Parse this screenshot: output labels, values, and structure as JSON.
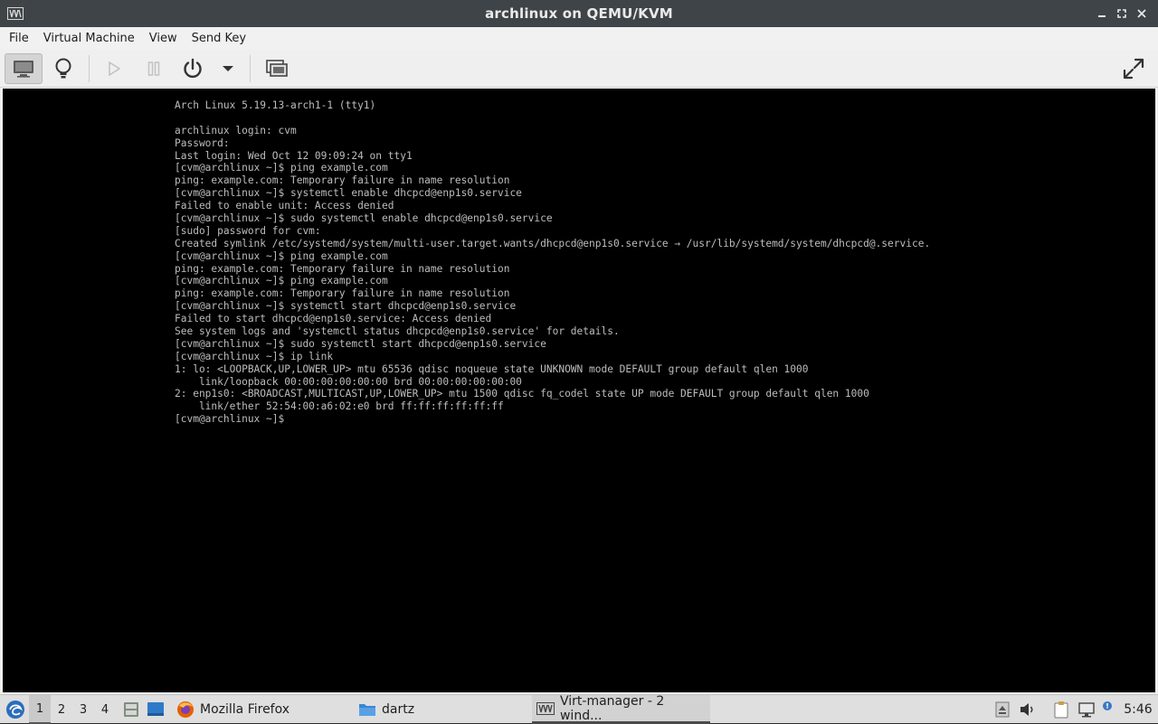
{
  "window": {
    "title": "archlinux on QEMU/KVM"
  },
  "menubar": {
    "items": [
      "File",
      "Virtual Machine",
      "View",
      "Send Key"
    ]
  },
  "toolbar": {
    "icons": [
      "console-icon",
      "lightbulb-icon",
      "play-icon",
      "pause-icon",
      "power-icon",
      "chevron-down-icon",
      "snapshots-icon",
      "fullscreen-icon"
    ]
  },
  "console": {
    "lines": [
      "Arch Linux 5.19.13-arch1-1 (tty1)",
      "",
      "archlinux login: cvm",
      "Password:",
      "Last login: Wed Oct 12 09:09:24 on tty1",
      "[cvm@archlinux ~]$ ping example.com",
      "ping: example.com: Temporary failure in name resolution",
      "[cvm@archlinux ~]$ systemctl enable dhcpcd@enp1s0.service",
      "Failed to enable unit: Access denied",
      "[cvm@archlinux ~]$ sudo systemctl enable dhcpcd@enp1s0.service",
      "[sudo] password for cvm:",
      "Created symlink /etc/systemd/system/multi-user.target.wants/dhcpcd@enp1s0.service → /usr/lib/systemd/system/dhcpcd@.service.",
      "[cvm@archlinux ~]$ ping example.com",
      "ping: example.com: Temporary failure in name resolution",
      "[cvm@archlinux ~]$ ping example.com",
      "ping: example.com: Temporary failure in name resolution",
      "[cvm@archlinux ~]$ systemctl start dhcpcd@enp1s0.service",
      "Failed to start dhcpcd@enp1s0.service: Access denied",
      "See system logs and 'systemctl status dhcpcd@enp1s0.service' for details.",
      "[cvm@archlinux ~]$ sudo systemctl start dhcpcd@enp1s0.service",
      "[cvm@archlinux ~]$ ip link",
      "1: lo: <LOOPBACK,UP,LOWER_UP> mtu 65536 qdisc noqueue state UNKNOWN mode DEFAULT group default qlen 1000",
      "    link/loopback 00:00:00:00:00:00 brd 00:00:00:00:00:00",
      "2: enp1s0: <BROADCAST,MULTICAST,UP,LOWER_UP> mtu 1500 qdisc fq_codel state UP mode DEFAULT group default qlen 1000",
      "    link/ether 52:54:00:a6:02:e0 brd ff:ff:ff:ff:ff:ff",
      "[cvm@archlinux ~]$"
    ]
  },
  "taskbar": {
    "workspaces": [
      "1",
      "2",
      "3",
      "4"
    ],
    "current_workspace": "1",
    "tasks": [
      {
        "label": "Mozilla Firefox",
        "icon": "firefox-icon"
      },
      {
        "label": "dartz",
        "icon": "folder-icon"
      },
      {
        "label": "Virt-manager - 2 wind...",
        "icon": "virt-manager-icon"
      }
    ],
    "clock": "5:46"
  },
  "colors": {
    "titlebar": "#3f4448",
    "console_bg": "#000000",
    "console_text": "#bdbdbd",
    "taskbar": "#dfdfdf"
  }
}
